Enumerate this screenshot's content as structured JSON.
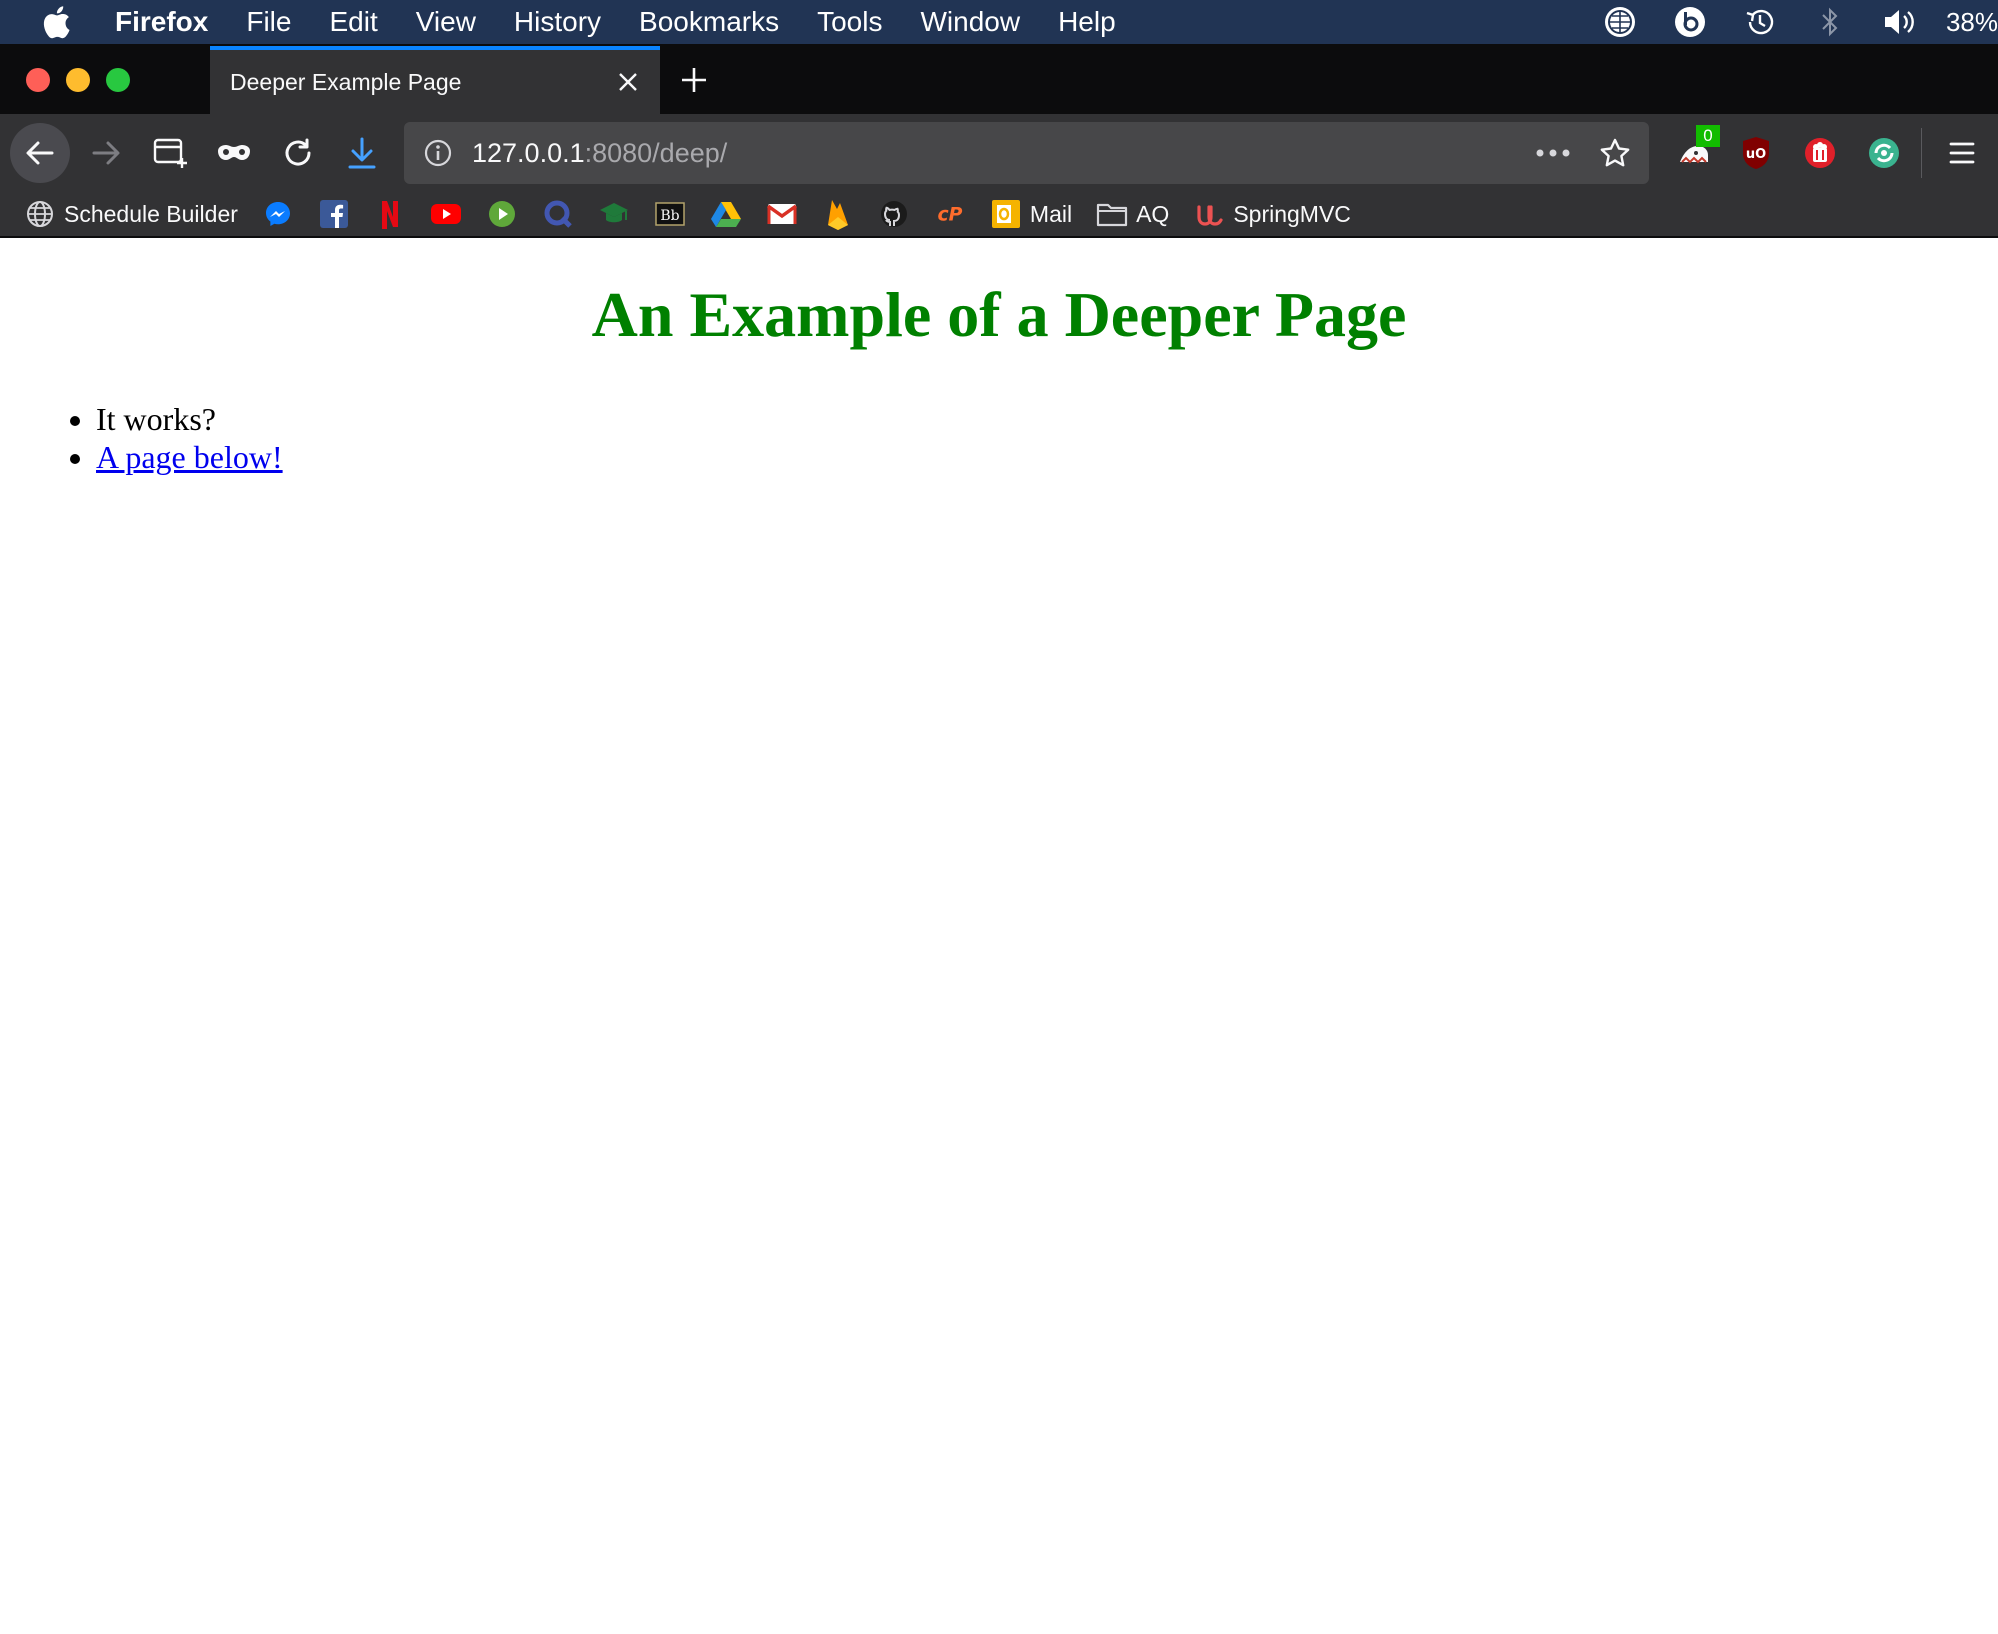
{
  "menubar": {
    "app_name": "Firefox",
    "items": [
      "File",
      "Edit",
      "View",
      "History",
      "Bookmarks",
      "Tools",
      "Window",
      "Help"
    ],
    "status_icons": [
      "vpn-globe-icon",
      "beats-icon",
      "time-machine-icon",
      "bluetooth-icon",
      "volume-icon"
    ],
    "battery_text": "38%"
  },
  "tab": {
    "title": "Deeper Example Page"
  },
  "toolbar": {
    "url_host": "127.0.0.1",
    "url_rest": ":8080/deep/",
    "extension_badge": "0",
    "accent_color": "#0a84ff"
  },
  "bookmarks": [
    {
      "label": "Schedule Builder",
      "icon": "globe-icon"
    },
    {
      "label": "",
      "icon": "messenger-icon"
    },
    {
      "label": "",
      "icon": "facebook-icon"
    },
    {
      "label": "",
      "icon": "netflix-icon"
    },
    {
      "label": "",
      "icon": "youtube-icon"
    },
    {
      "label": "",
      "icon": "play-icon"
    },
    {
      "label": "",
      "icon": "q-icon"
    },
    {
      "label": "",
      "icon": "graduation-cap-icon"
    },
    {
      "label": "",
      "icon": "blackboard-icon"
    },
    {
      "label": "",
      "icon": "google-drive-icon"
    },
    {
      "label": "",
      "icon": "gmail-icon"
    },
    {
      "label": "",
      "icon": "firebase-icon"
    },
    {
      "label": "",
      "icon": "github-icon"
    },
    {
      "label": "",
      "icon": "cpanel-icon"
    },
    {
      "label": "Mail",
      "icon": "outlook-icon"
    },
    {
      "label": "AQ",
      "icon": "folder-icon"
    },
    {
      "label": "SpringMVC",
      "icon": "udemy-icon"
    }
  ],
  "page": {
    "heading": "An Example of a Deeper Page",
    "heading_color": "#008000",
    "list_item_1": "It works?",
    "list_item_2_link": "A page below!"
  }
}
